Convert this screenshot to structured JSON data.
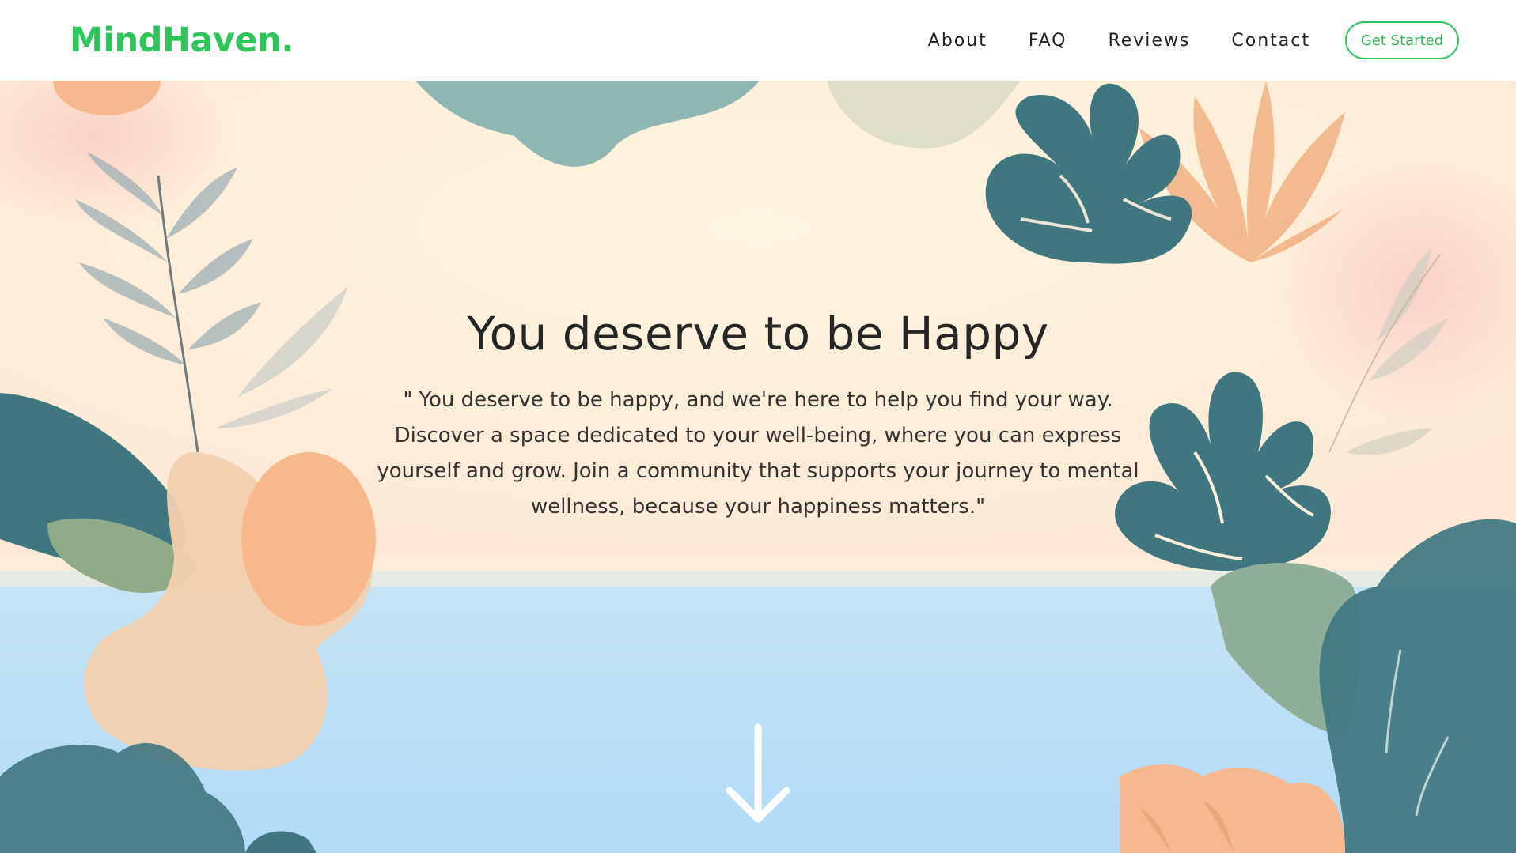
{
  "brand": {
    "logo": "MindHaven.",
    "accent_color": "#2fc55a"
  },
  "nav": {
    "links": [
      "About",
      "FAQ",
      "Reviews",
      "Contact"
    ],
    "cta_label": "Get Started"
  },
  "hero": {
    "title": "You deserve to be Happy",
    "quote": "\" You deserve to be happy, and we're here to help you find your way. Discover a space dedicated to your well-being, where you can express yourself and grow. Join a community that supports your journey to mental wellness, because your happiness matters.\"",
    "scroll_icon": "arrow-down-icon"
  },
  "palette": {
    "cream": "#fdf1dd",
    "peach": "#f6b98f",
    "teal": "#3f7680",
    "sage": "#8fae98",
    "sky": "#b7dcf4"
  }
}
